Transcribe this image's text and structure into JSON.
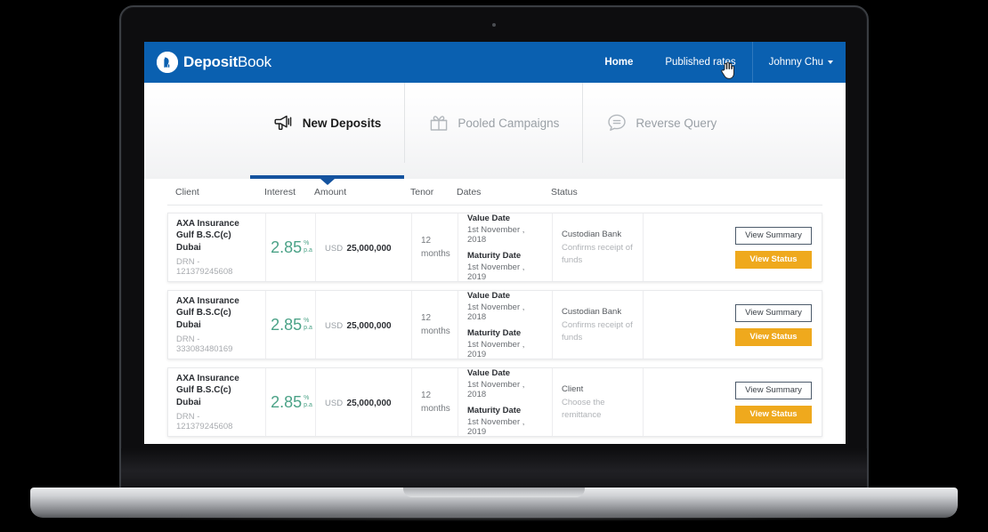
{
  "header": {
    "brand_bold": "Deposit",
    "brand_light": "Book",
    "brand_icon": "deposit-book-logo-icon",
    "nav": {
      "home": "Home",
      "published_rates": "Published rates",
      "user": "Johnny Chu"
    },
    "brand_color": "#0a60b0"
  },
  "tabs": [
    {
      "label": "New Deposits",
      "icon": "megaphone-icon",
      "active": true
    },
    {
      "label": "Pooled Campaigns",
      "icon": "gift-icon",
      "active": false
    },
    {
      "label": "Reverse Query",
      "icon": "chat-bubble-icon",
      "active": false
    }
  ],
  "table": {
    "columns": {
      "client": "Client",
      "interest": "Interest",
      "amount": "Amount",
      "tenor": "Tenor",
      "dates": "Dates",
      "status": "Status"
    },
    "labels": {
      "value_date": "Value Date",
      "maturity_date": "Maturity Date"
    },
    "buttons": {
      "view_summary": "View Summary",
      "view_status": "View Status"
    },
    "accent_green": "#4ba287",
    "accent_orange": "#efa91d",
    "rows": [
      {
        "client_name": "AXA Insurance Gulf B.S.C(c) Dubai",
        "client_drn": "DRN - 121379245608",
        "rate": "2.85",
        "rate_unit_top": "%",
        "rate_unit_bottom": "p.a",
        "currency": "USD",
        "amount": "25,000,000",
        "tenor": "12 months",
        "value_date": "1st November , 2018",
        "maturity_date": "1st November , 2019",
        "status_title": "Custodian Bank",
        "status_desc": "Confirms receipt of funds"
      },
      {
        "client_name": "AXA Insurance Gulf B.S.C(c) Dubai",
        "client_drn": "DRN - 333083480169",
        "rate": "2.85",
        "rate_unit_top": "%",
        "rate_unit_bottom": "p.a",
        "currency": "USD",
        "amount": "25,000,000",
        "tenor": "12 months",
        "value_date": "1st November , 2018",
        "maturity_date": "1st November , 2019",
        "status_title": "Custodian Bank",
        "status_desc": "Confirms receipt of funds"
      },
      {
        "client_name": "AXA Insurance Gulf B.S.C(c) Dubai",
        "client_drn": "DRN - 121379245608",
        "rate": "2.85",
        "rate_unit_top": "%",
        "rate_unit_bottom": "p.a",
        "currency": "USD",
        "amount": "25,000,000",
        "tenor": "12 months",
        "value_date": "1st November , 2018",
        "maturity_date": "1st November , 2019",
        "status_title": "Client",
        "status_desc": "Choose the remittance"
      }
    ]
  }
}
